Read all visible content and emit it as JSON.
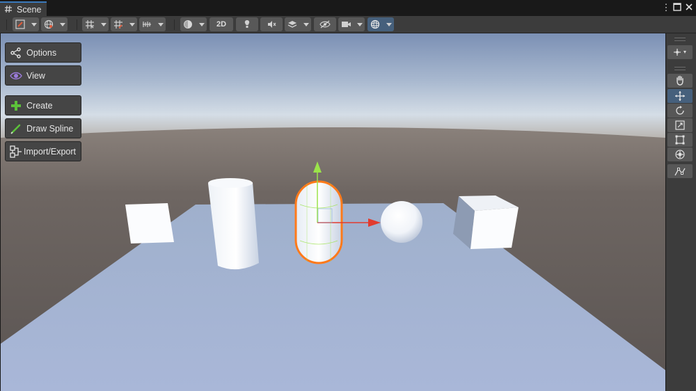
{
  "window": {
    "tab_title": "Scene",
    "menu_glyph": "⋮",
    "maximize_glyph": "□",
    "close_glyph": "✕"
  },
  "toolbar": {
    "mode_2d_label": "2D",
    "icons": [
      "draw-mode-icon",
      "globe-icon",
      "grid-snap-icon",
      "grid-icon",
      "increment-snap-icon",
      "shading-icon",
      "audio-icon",
      "lighting-icon",
      "effects-icon",
      "visibility-icon",
      "camera-icon",
      "gizmos-icon"
    ]
  },
  "overlay": {
    "options_label": "Options",
    "view_label": "View",
    "create_label": "Create",
    "draw_spline_label": "Draw Spline",
    "import_export_label": "Import/Export"
  },
  "tools": {
    "icons": [
      "view-tool-icon",
      "move-tool-icon",
      "rotate-tool-icon",
      "scale-tool-icon",
      "rect-tool-icon",
      "transform-tool-icon",
      "custom-tool-icon"
    ],
    "active": "move-tool-icon"
  },
  "colors": {
    "selection_outline": "#ff7a1a",
    "gizmo_y": "#9be34a",
    "gizmo_x": "#e23b2e",
    "active_tool": "#46607c",
    "tab_accent": "#3a79bb"
  }
}
